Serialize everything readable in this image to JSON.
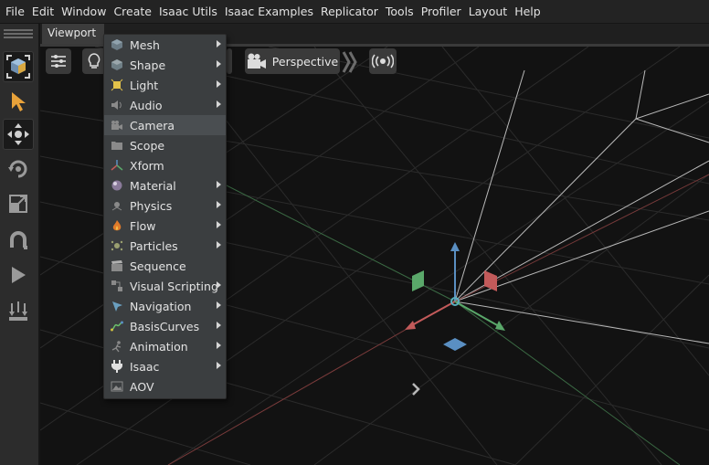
{
  "menubar": {
    "items": [
      "File",
      "Edit",
      "Window",
      "Create",
      "Isaac Utils",
      "Isaac Examples",
      "Replicator",
      "Tools",
      "Profiler",
      "Layout",
      "Help"
    ]
  },
  "viewport_tab": {
    "label": "Viewport"
  },
  "viewport_toolbar": {
    "camera_label": "Perspective"
  },
  "create_menu": {
    "items": [
      {
        "label": "Mesh",
        "icon": "mesh-icon",
        "submenu": true
      },
      {
        "label": "Shape",
        "icon": "shape-icon",
        "submenu": true
      },
      {
        "label": "Light",
        "icon": "light-icon",
        "submenu": true
      },
      {
        "label": "Audio",
        "icon": "audio-icon",
        "submenu": true
      },
      {
        "label": "Camera",
        "icon": "camera-icon",
        "submenu": false,
        "hovered": true
      },
      {
        "label": "Scope",
        "icon": "folder-icon",
        "submenu": false
      },
      {
        "label": "Xform",
        "icon": "xform-icon",
        "submenu": false
      },
      {
        "label": "Material",
        "icon": "material-sphere-icon",
        "submenu": true
      },
      {
        "label": "Physics",
        "icon": "physics-icon",
        "submenu": true
      },
      {
        "label": "Flow",
        "icon": "flame-icon",
        "submenu": true
      },
      {
        "label": "Particles",
        "icon": "particles-icon",
        "submenu": true
      },
      {
        "label": "Sequence",
        "icon": "clapperboard-icon",
        "submenu": false
      },
      {
        "label": "Visual Scripting",
        "icon": "visual-scripting-icon",
        "submenu": true
      },
      {
        "label": "Navigation",
        "icon": "navigation-icon",
        "submenu": true
      },
      {
        "label": "BasisCurves",
        "icon": "curve-icon",
        "submenu": true
      },
      {
        "label": "Animation",
        "icon": "animation-icon",
        "submenu": true
      },
      {
        "label": "Isaac",
        "icon": "plug-icon",
        "submenu": true
      },
      {
        "label": "AOV",
        "icon": "image-icon",
        "submenu": false
      }
    ]
  },
  "colors": {
    "menubar_bg": "#232323",
    "menu_bg": "#3b3e40",
    "axis_x": "#c25a5a",
    "axis_y": "#5a8fc2",
    "axis_z": "#5aa86a"
  }
}
